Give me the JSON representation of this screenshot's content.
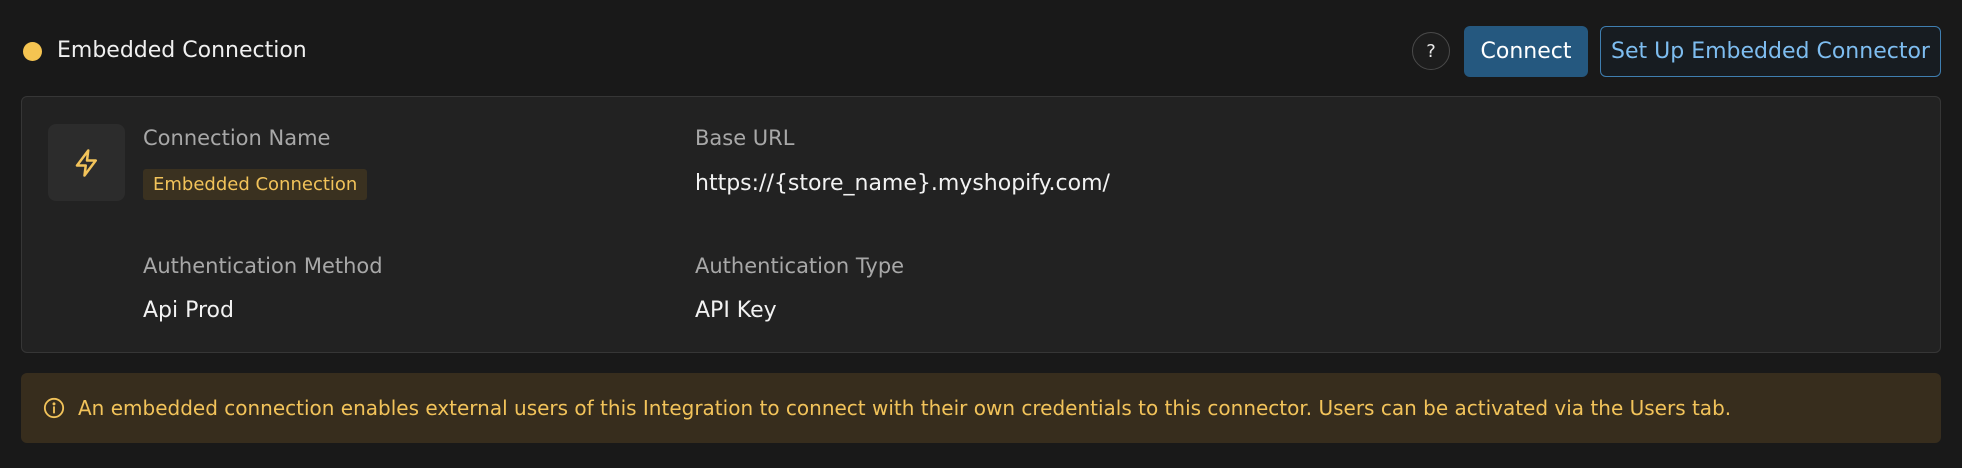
{
  "header": {
    "status_color": "#f5c451",
    "title": "Embedded Connection",
    "help_label": "?",
    "connect_label": "Connect",
    "setup_label": "Set Up Embedded Connector"
  },
  "card": {
    "icon": "bolt-icon",
    "connection_name_label": "Connection Name",
    "connection_name_value": "Embedded Connection",
    "base_url_label": "Base URL",
    "base_url_value": "https://{store_name}.myshopify.com/",
    "auth_method_label": "Authentication Method",
    "auth_method_value": "Api Prod",
    "auth_type_label": "Authentication Type",
    "auth_type_value": "API Key"
  },
  "banner": {
    "icon": "info-icon",
    "text": "An embedded connection enables external users of this Integration to connect with their own credentials to this connector. Users can be activated via the Users tab."
  },
  "colors": {
    "accent_yellow": "#f2c35a",
    "primary_blue": "#25587f",
    "outline_blue": "#3f7eb0"
  }
}
